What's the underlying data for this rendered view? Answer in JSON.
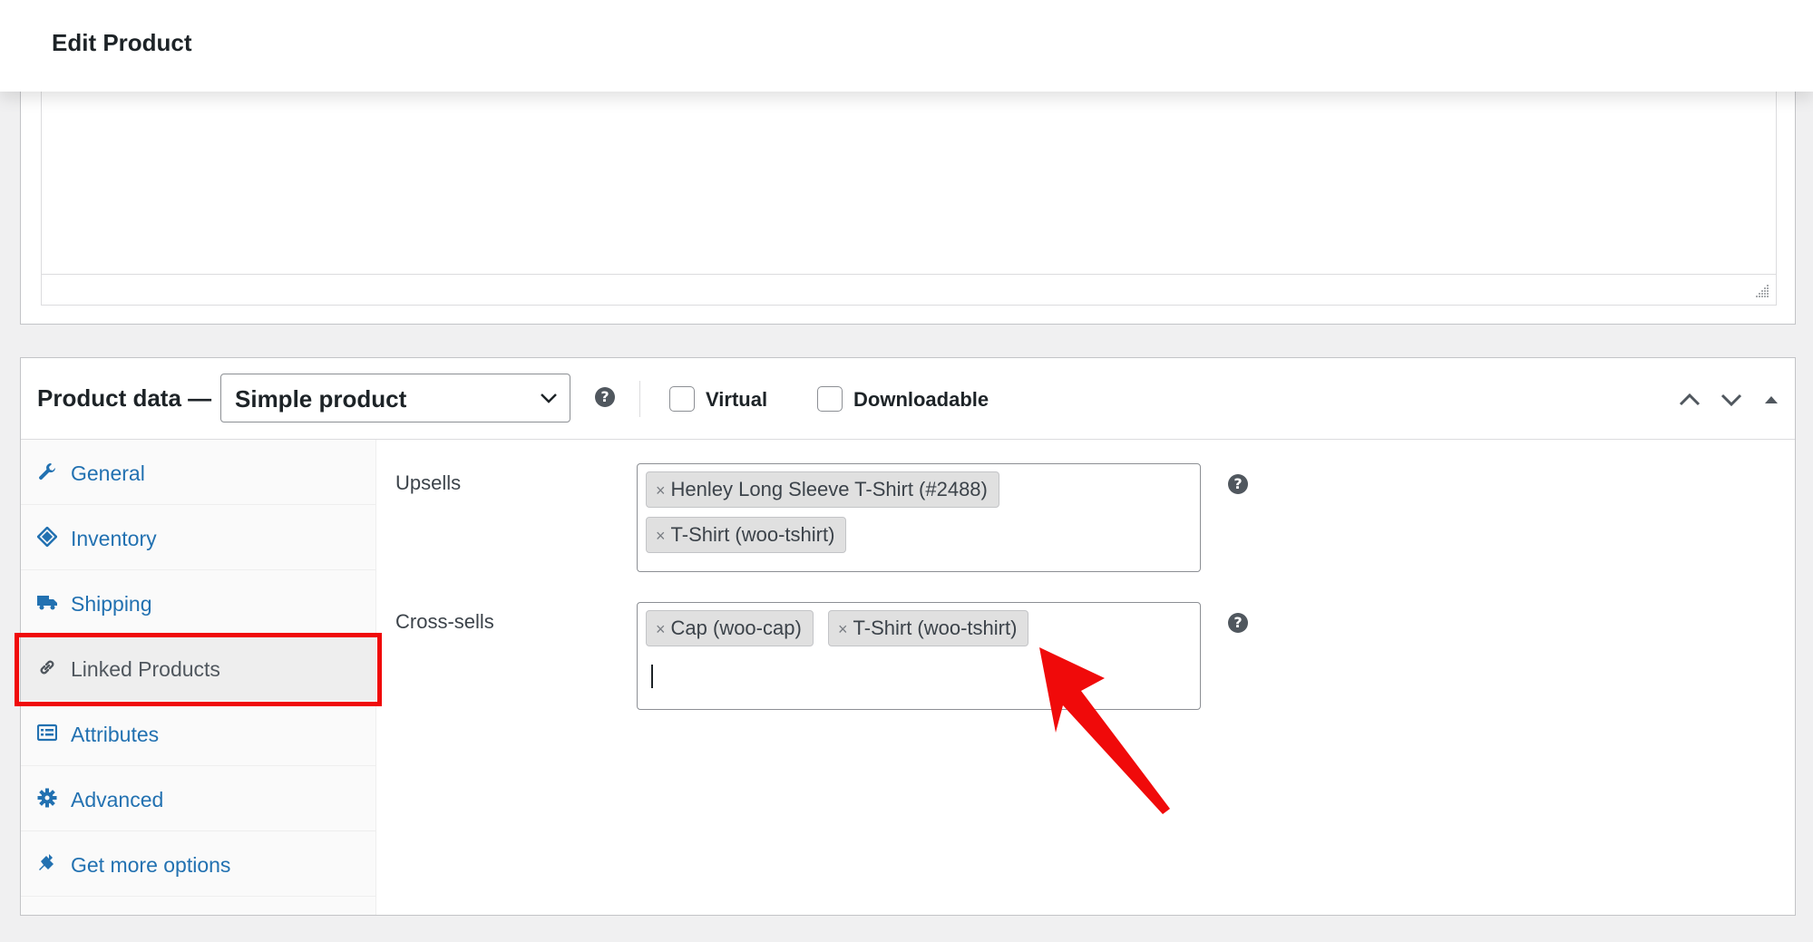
{
  "header": {
    "title": "Edit Product"
  },
  "product_data": {
    "label": "Product data —",
    "type_select": {
      "value": "Simple product"
    },
    "help_glyph": "?",
    "virtual_label": "Virtual",
    "downloadable_label": "Downloadable",
    "virtual_checked": false,
    "downloadable_checked": false
  },
  "tabs": [
    {
      "label": "General",
      "icon": "wrench-icon"
    },
    {
      "label": "Inventory",
      "icon": "tag-icon"
    },
    {
      "label": "Shipping",
      "icon": "truck-icon"
    },
    {
      "label": "Linked Products",
      "icon": "link-icon",
      "active": true
    },
    {
      "label": "Attributes",
      "icon": "list-icon"
    },
    {
      "label": "Advanced",
      "icon": "gear-icon"
    },
    {
      "label": "Get more options",
      "icon": "plugin-icon"
    }
  ],
  "linked_products": {
    "upsells": {
      "label": "Upsells",
      "tags": [
        {
          "remove": "×",
          "text": "Henley Long Sleeve T-Shirt (#2488)"
        },
        {
          "remove": "×",
          "text": "T-Shirt (woo-tshirt)"
        }
      ]
    },
    "cross_sells": {
      "label": "Cross-sells",
      "tags": [
        {
          "remove": "×",
          "text": "Cap (woo-cap)"
        },
        {
          "remove": "×",
          "text": "T-Shirt (woo-tshirt)"
        }
      ]
    }
  },
  "annotation": {
    "highlight_color": "#f00a0a",
    "arrow_color": "#f00a0a"
  }
}
